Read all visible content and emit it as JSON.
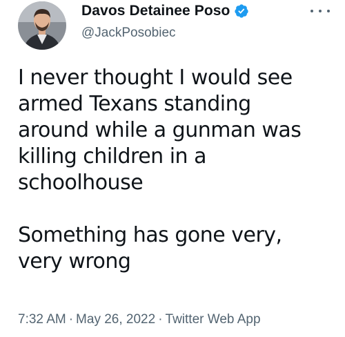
{
  "author": {
    "display_name": "Davos Detainee Poso",
    "handle": "@JackPosobiec",
    "verified_icon": "verified-badge-icon",
    "avatar_icon": "avatar-photo"
  },
  "tweet": {
    "lines": [
      "I never thought I would see",
      "armed Texans standing",
      "around while a gunman was",
      "killing children in a",
      "schoolhouse",
      "",
      "Something has gone very,",
      "very wrong"
    ]
  },
  "meta": {
    "time": "7:32 AM",
    "separator": "·",
    "date": "May 26, 2022",
    "source": "Twitter Web App"
  },
  "colors": {
    "text": "#0f1419",
    "secondary": "#536471",
    "verified_blue": "#1d9bf0"
  }
}
